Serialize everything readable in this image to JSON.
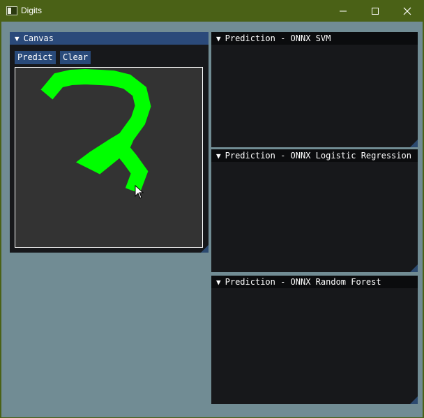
{
  "window": {
    "title": "Digits",
    "minimize_icon": "minimize-icon",
    "maximize_icon": "maximize-icon",
    "close_icon": "close-icon"
  },
  "canvas_panel": {
    "title": "Canvas",
    "collapse_icon": "triangle-down-icon",
    "predict_label": "Predict",
    "clear_label": "Clear",
    "stroke_color": "#00ff00",
    "background_color": "#333333"
  },
  "prediction_panels": [
    {
      "title": "Prediction - ONNX SVM"
    },
    {
      "title": "Prediction - ONNX Logistic Regression"
    },
    {
      "title": "Prediction - ONNX Random Forest"
    }
  ],
  "colors": {
    "titlebar": "#4a6116",
    "client_background": "#718c94",
    "panel_background": "#17181b",
    "active_header": "#2b4a7a",
    "button": "#294a7a"
  }
}
